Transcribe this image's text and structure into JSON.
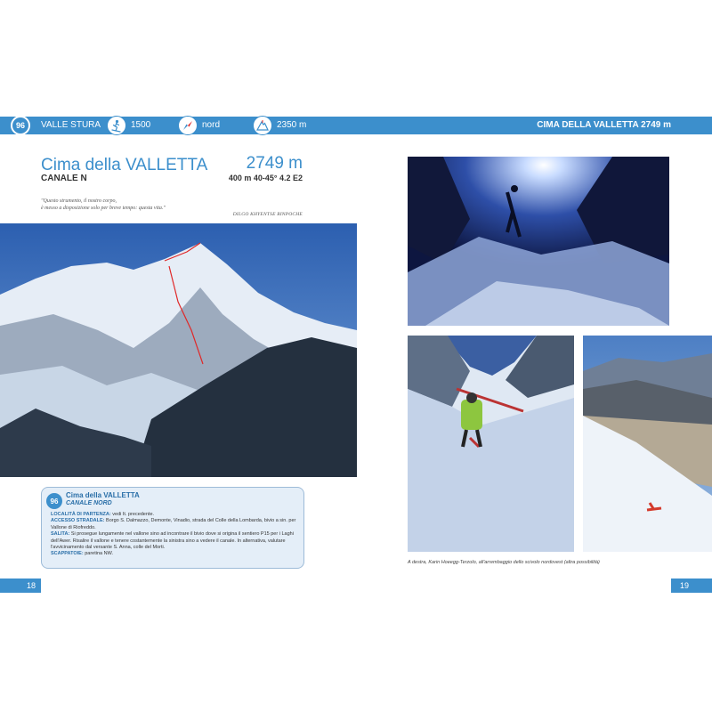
{
  "header": {
    "number": "96",
    "region": "VALLE STURA",
    "start_altitude": "1500",
    "exposure": "nord",
    "summit_altitude": "2350 m",
    "right_title": "CIMA DELLA VALLETTA 2749 m"
  },
  "route": {
    "title": "Cima della VALLETTA",
    "altitude": "2749 m",
    "subtitle": "CANALE N",
    "spec": "400 m 40-45° 4.2 E2",
    "quote_line1": "\"Questo strumento, il nostro corpo,",
    "quote_line2": "è messo a disposizione solo per breve tempo: questa vita.\"",
    "quote_author": "DILGO KHYENTSE RINPOCHE"
  },
  "infobox": {
    "number": "96",
    "title": "Cima della VALLETTA",
    "subtitle": "CANALE NORD",
    "partenza_label": "LOCALITÀ DI PARTENZA:",
    "partenza": " vedi It. precedente.",
    "accesso_label": "ACCESSO STRADALE:",
    "accesso": " Borgo S. Dalmazzo, Demonte, Vinadio, strada del Colle della Lombarda, bivio a sin. per Vallone di Riofreddo.",
    "salita_label": "SALITA:",
    "salita": " Si prosegue lungamente nel vallone sino ad incontrare il bivio dove si origina il sentiero P15 per i Laghi dell'Awer. Risalire il vallone e tenere costantemente la sinistra sino a vedere il canale. In alternativa, valutare l'avvicinamento dal versante S. Anna, colle del Morti.",
    "scappatoie_label": "SCAPPATOIE:",
    "scappatoie": " paretina NW."
  },
  "caption": "A destra, Karin Hoeegg-Terzolo, all'arrembaggio dello scivolo nordovest (altra possibilità)",
  "pages": {
    "left": "18",
    "right": "19"
  },
  "colors": {
    "accent": "#3c8fcc",
    "box": "#e4eef8"
  }
}
